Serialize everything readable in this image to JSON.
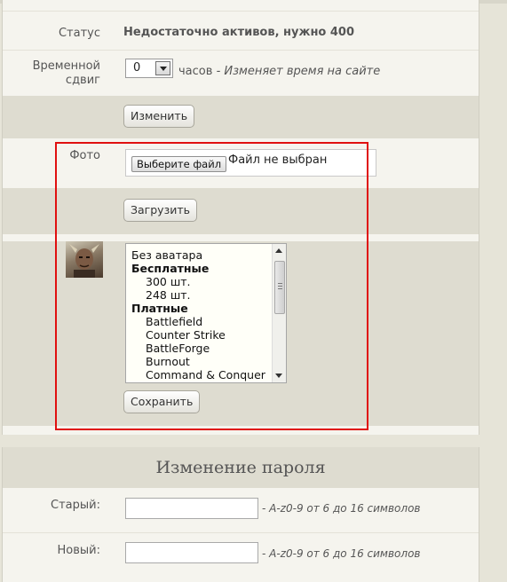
{
  "profile": {
    "status": {
      "label": "Статус",
      "value": "Недостаточно активов, нужно 400"
    },
    "timeshift": {
      "label_line1": "Временной",
      "label_line2": "сдвиг",
      "selected": "0",
      "unit": "часов",
      "hint": "- Изменяет время на сайте"
    },
    "change_button": "Изменить",
    "photo": {
      "label": "Фото",
      "choose_button": "Выберите файл",
      "no_file_text": "Файл не выбран",
      "upload_button": "Загрузить"
    },
    "avatar_select": {
      "icon": "warrior-avatar-icon",
      "options": [
        {
          "text": "Без аватара",
          "type": "option"
        },
        {
          "text": "Бесплатные",
          "type": "group"
        },
        {
          "text": "300 шт.",
          "type": "sub"
        },
        {
          "text": "248 шт.",
          "type": "sub"
        },
        {
          "text": "Платные",
          "type": "group"
        },
        {
          "text": "Battlefield",
          "type": "sub"
        },
        {
          "text": "Counter Strike",
          "type": "sub"
        },
        {
          "text": "BattleForge",
          "type": "sub"
        },
        {
          "text": "Burnout",
          "type": "sub"
        },
        {
          "text": "Command & Conquer",
          "type": "sub"
        }
      ],
      "save_button": "Сохранить"
    }
  },
  "password": {
    "title": "Изменение пароля",
    "old": {
      "label": "Старый:",
      "value": "",
      "hint": "- A-z0-9 от 6 до 16 символов"
    },
    "new": {
      "label": "Новый:",
      "value": "",
      "hint": "- A-z0-9 от 6 до 16 символов"
    }
  },
  "colors": {
    "highlight": "#e01010",
    "panel": "#f5f4ee",
    "alt_row": "#dedcd0"
  }
}
